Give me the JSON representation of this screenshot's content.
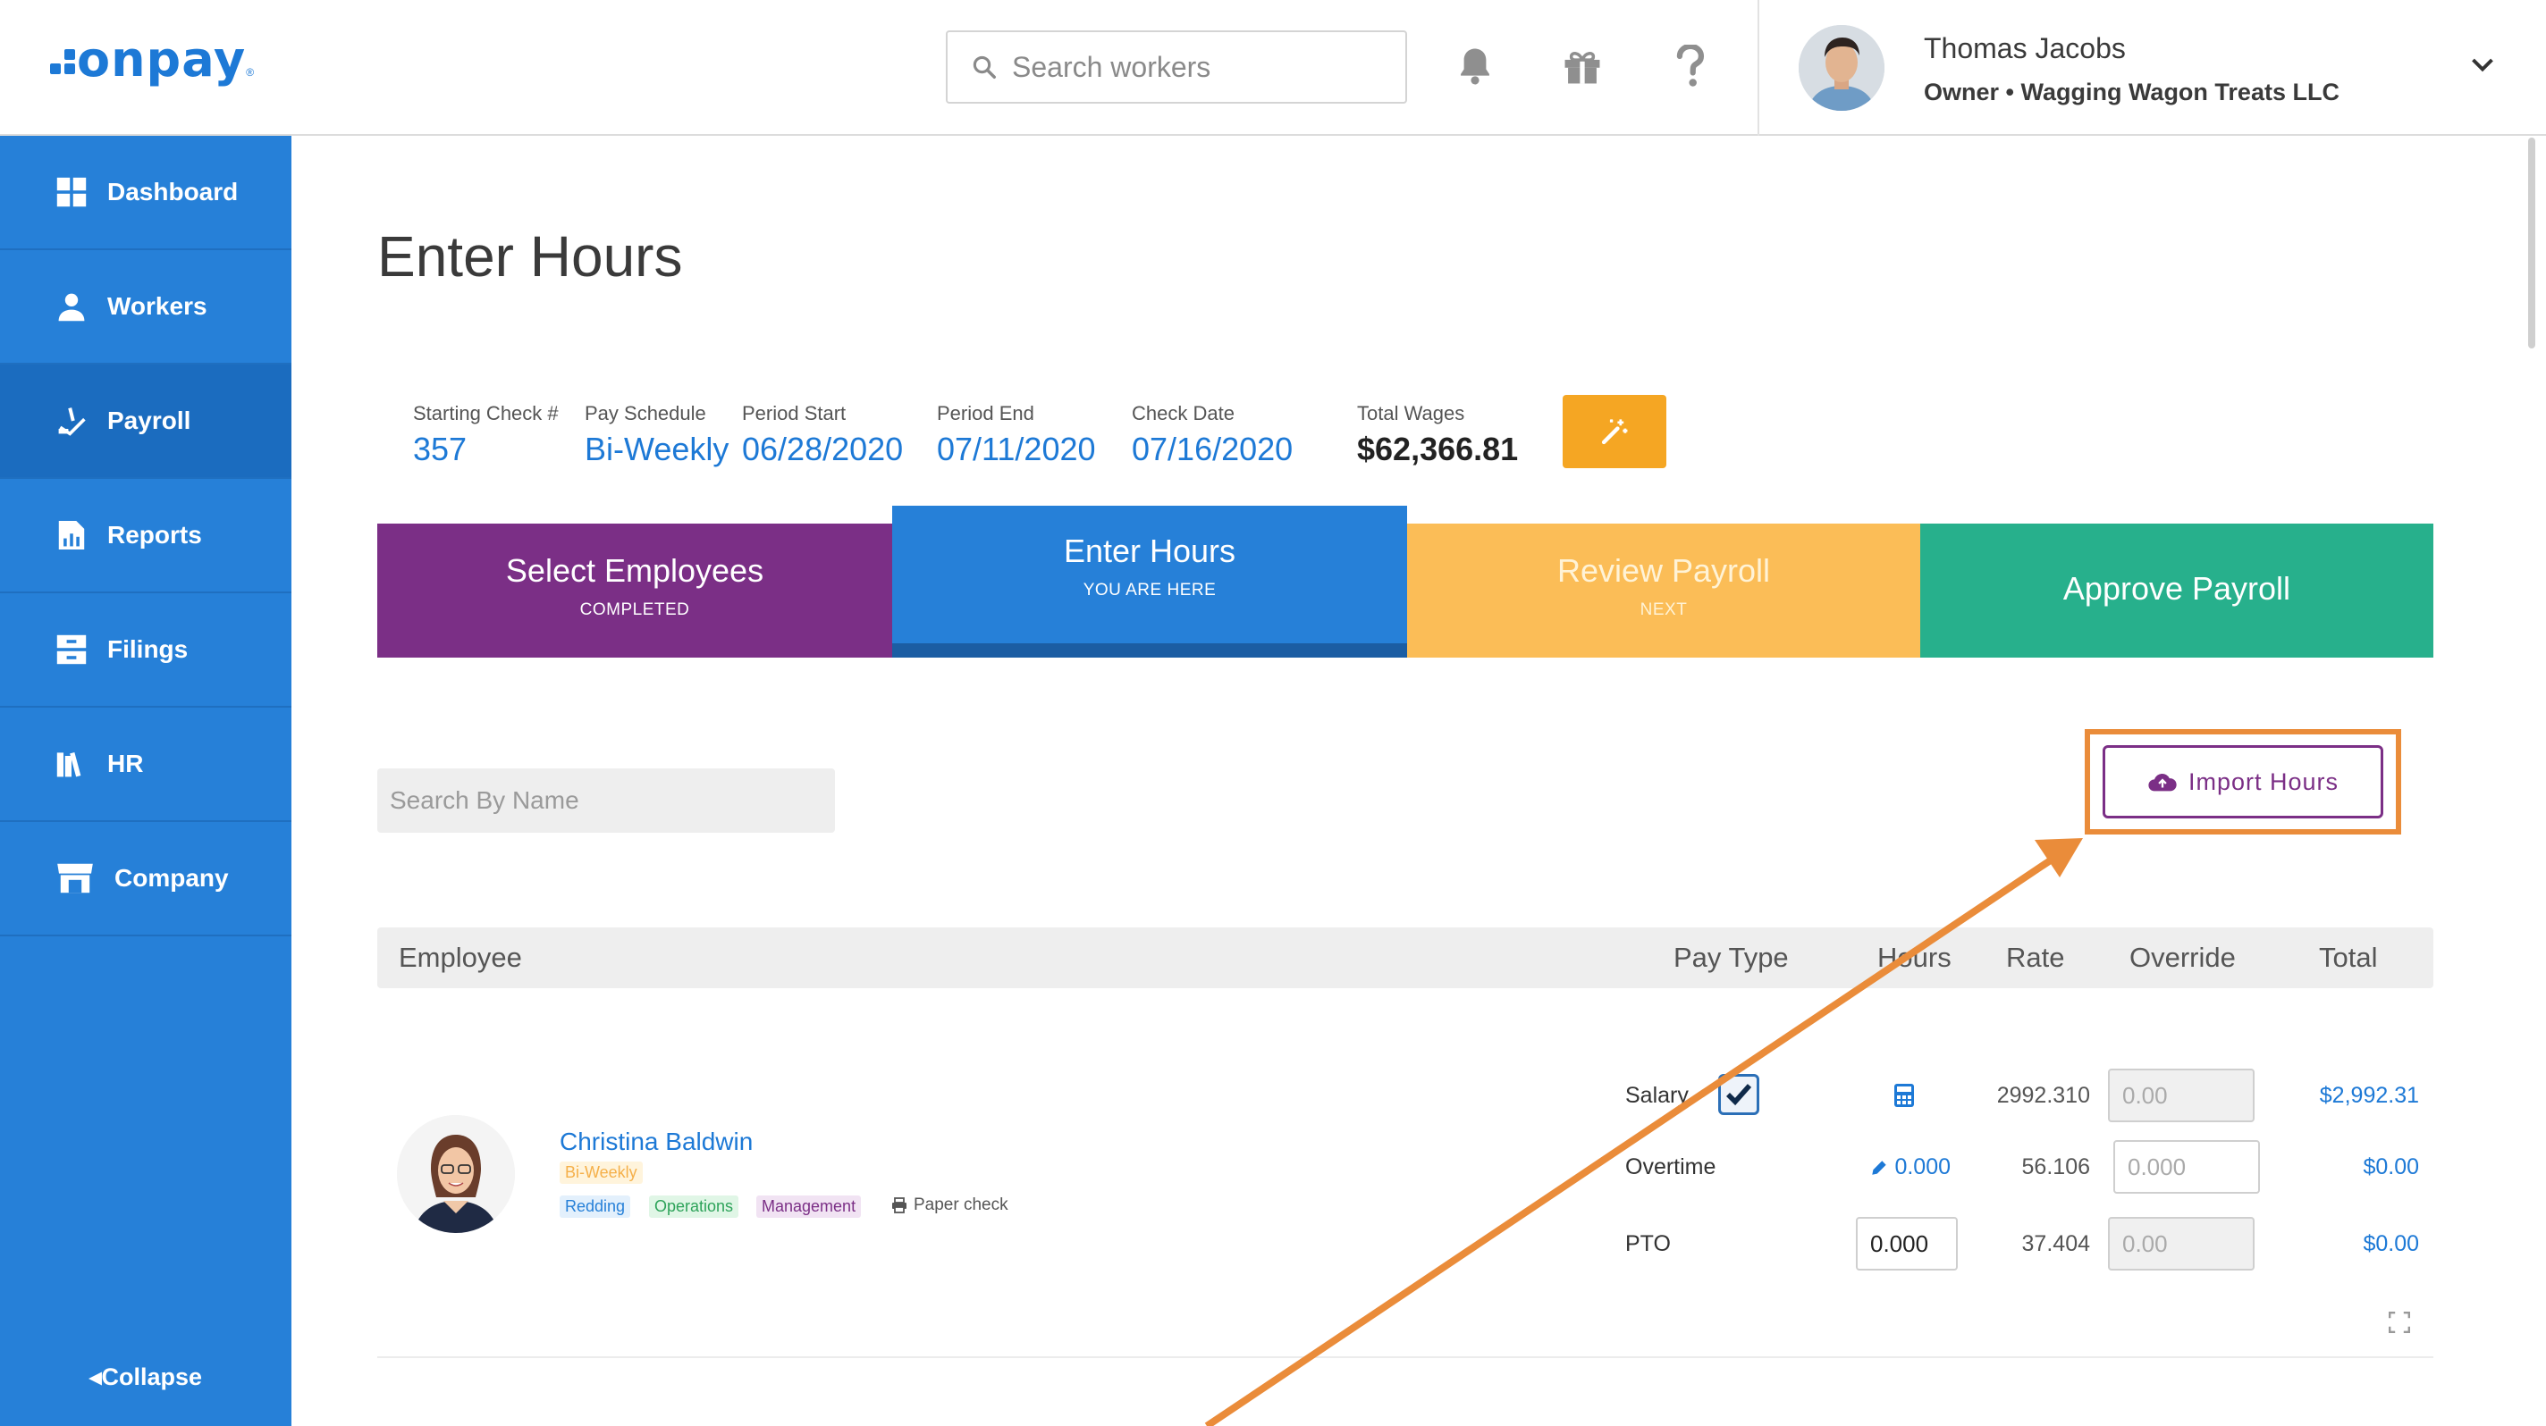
{
  "app": {
    "logo": "onpay",
    "logo_mark": "®"
  },
  "header": {
    "search_placeholder": "Search workers",
    "user_name": "Thomas Jacobs",
    "user_subtitle": "Owner • Wagging Wagon Treats LLC"
  },
  "sidebar": {
    "items": [
      {
        "label": "Dashboard",
        "icon": "dashboard-icon"
      },
      {
        "label": "Workers",
        "icon": "workers-icon"
      },
      {
        "label": "Payroll",
        "icon": "payroll-icon",
        "active": true
      },
      {
        "label": "Reports",
        "icon": "reports-icon"
      },
      {
        "label": "Filings",
        "icon": "filings-icon"
      },
      {
        "label": "HR",
        "icon": "hr-icon"
      },
      {
        "label": "Company",
        "icon": "company-icon"
      }
    ],
    "collapse_label": "Collapse"
  },
  "page": {
    "title": "Enter Hours"
  },
  "run_info": {
    "starting_check_label": "Starting Check #",
    "starting_check_value": "357",
    "pay_schedule_label": "Pay Schedule",
    "pay_schedule_value": "Bi-Weekly",
    "period_start_label": "Period Start",
    "period_start_value": "06/28/2020",
    "period_end_label": "Period End",
    "period_end_value": "07/11/2020",
    "check_date_label": "Check Date",
    "check_date_value": "07/16/2020",
    "total_wages_label": "Total Wages",
    "total_wages_value": "$62,366.81"
  },
  "steps": [
    {
      "title": "Select Employees",
      "subtitle": "COMPLETED",
      "color": "#7b2f86"
    },
    {
      "title": "Enter Hours",
      "subtitle": "YOU ARE HERE",
      "color": "#2680d8"
    },
    {
      "title": "Review Payroll",
      "subtitle": "NEXT",
      "color": "#fbbd57"
    },
    {
      "title": "Approve Payroll",
      "subtitle": "",
      "color": "#27b08c"
    }
  ],
  "filters": {
    "search_by_name_placeholder": "Search By Name"
  },
  "import": {
    "label": "Import Hours",
    "highlight_color": "#ea8c3a"
  },
  "table": {
    "headers": {
      "employee": "Employee",
      "pay_type": "Pay Type",
      "hours": "Hours",
      "rate": "Rate",
      "override": "Override",
      "total": "Total"
    },
    "employee": {
      "name": "Christina Baldwin",
      "schedule_badge": "Bi-Weekly",
      "tags": [
        "Redding",
        "Operations",
        "Management"
      ],
      "payment_method": "Paper check"
    },
    "rows": [
      {
        "pay_type": "Salary",
        "hours": "",
        "rate": "2992.310",
        "override_placeholder": "0.00",
        "total": "$2,992.31"
      },
      {
        "pay_type": "Overtime",
        "hours": "0.000",
        "rate": "56.106",
        "override_placeholder": "0.000",
        "total": "$0.00"
      },
      {
        "pay_type": "PTO",
        "hours": "0.000",
        "rate": "37.404",
        "override_placeholder": "0.00",
        "total": "$0.00"
      }
    ]
  }
}
